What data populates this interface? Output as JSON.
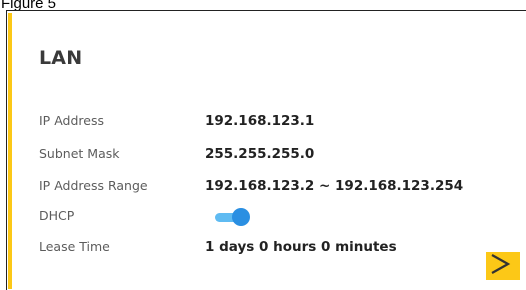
{
  "header": {
    "partial_caption": "Figure 5"
  },
  "lan_card": {
    "title": "LAN",
    "ip_address": {
      "label": "IP Address",
      "value": "192.168.123.1"
    },
    "subnet_mask": {
      "label": "Subnet Mask",
      "value": "255.255.255.0"
    },
    "ip_address_range": {
      "label": "IP Address Range",
      "value": "192.168.123.2 ~ 192.168.123.254"
    },
    "dhcp": {
      "label": "DHCP",
      "enabled": true
    },
    "lease_time": {
      "label": "Lease Time",
      "value": "1 days 0 hours 0 minutes"
    },
    "more_button_icon": "chevron-right-icon"
  },
  "colors": {
    "accent": "#fcc817",
    "toggle_on": "#2a8fe2",
    "toggle_track": "#5fbbf2",
    "label_text": "#5c5c5c",
    "value_text": "#222222"
  }
}
